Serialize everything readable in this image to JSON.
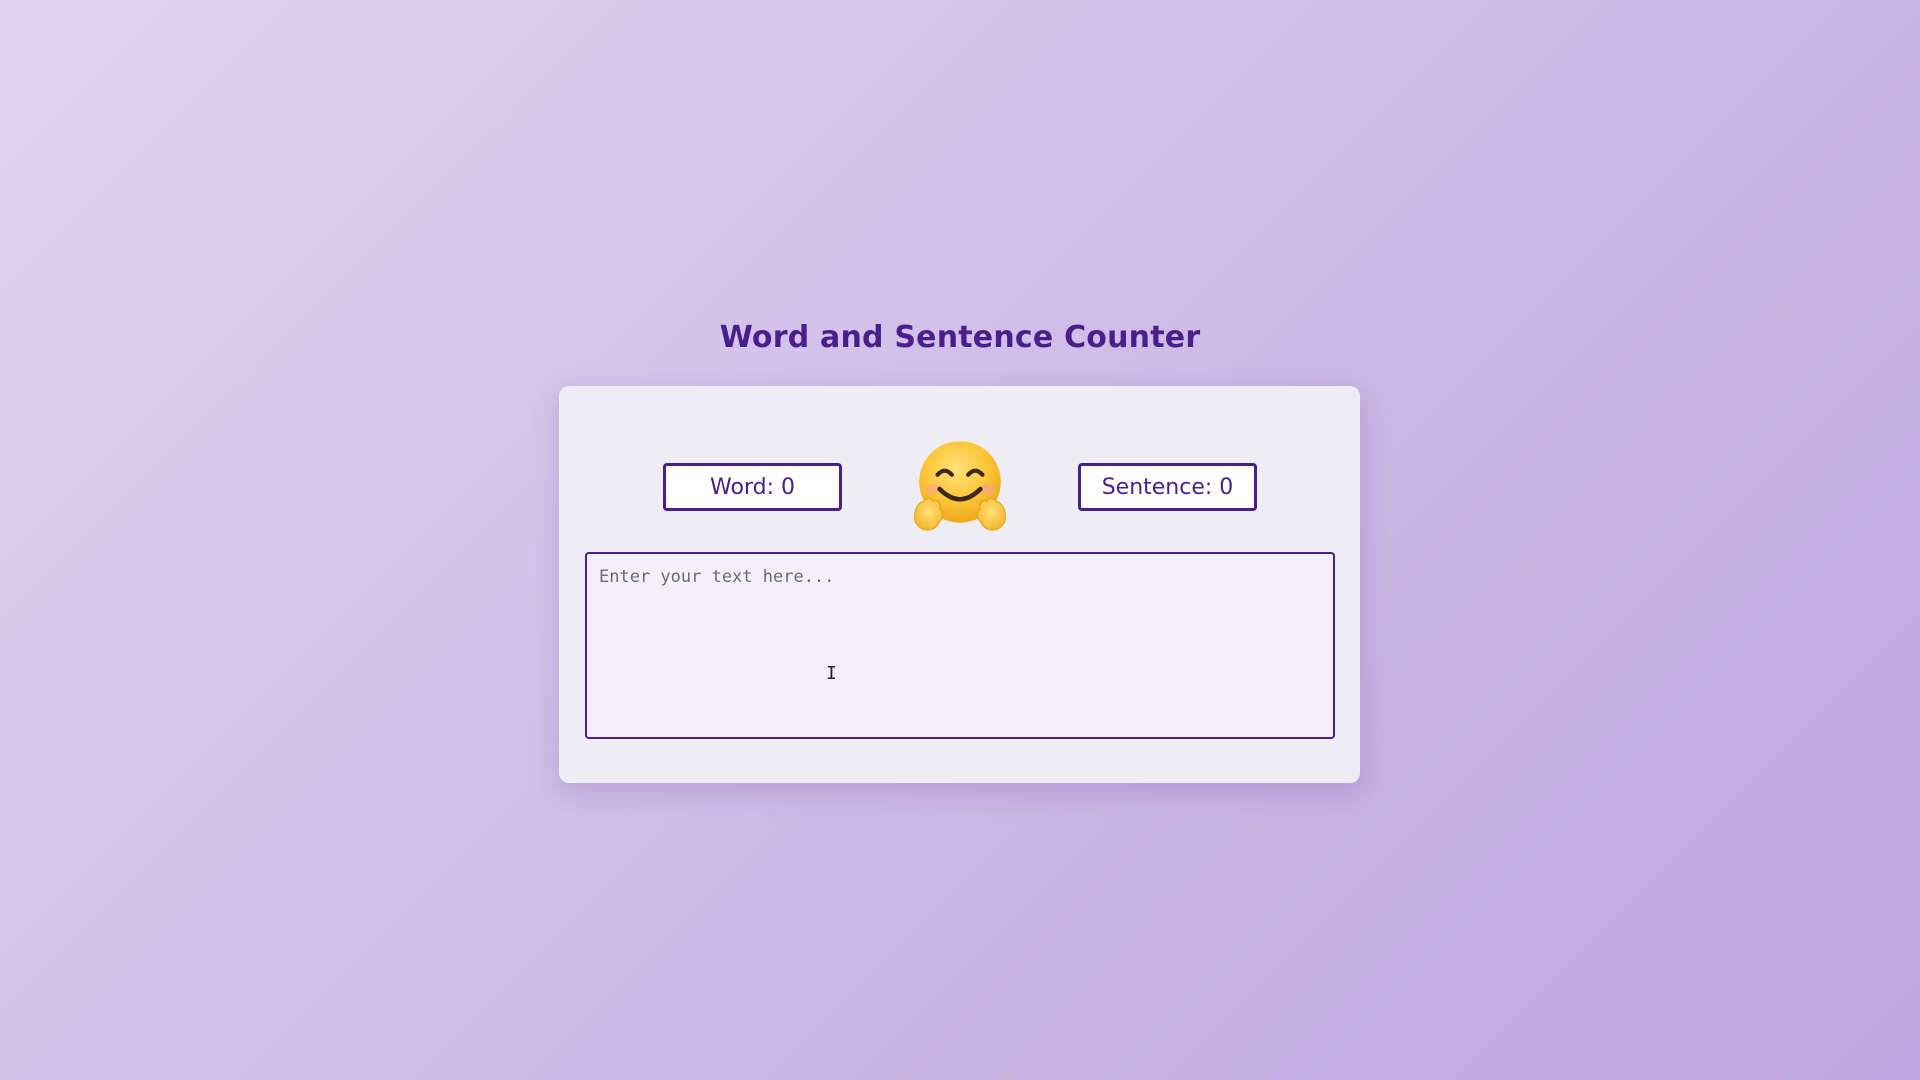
{
  "page": {
    "title": "Word and Sentence Counter"
  },
  "counters": {
    "word_label": "Word: 0",
    "sentence_label": "Sentence: 0"
  },
  "mood": {
    "icon": "hugging-face-emoji"
  },
  "editor": {
    "placeholder": "Enter your text here...",
    "value": ""
  },
  "colors": {
    "accent": "#4a1f8c",
    "card_background": "#efedf4",
    "page_gradient_start": "#e0d4f0",
    "page_gradient_end": "#bea6de"
  }
}
